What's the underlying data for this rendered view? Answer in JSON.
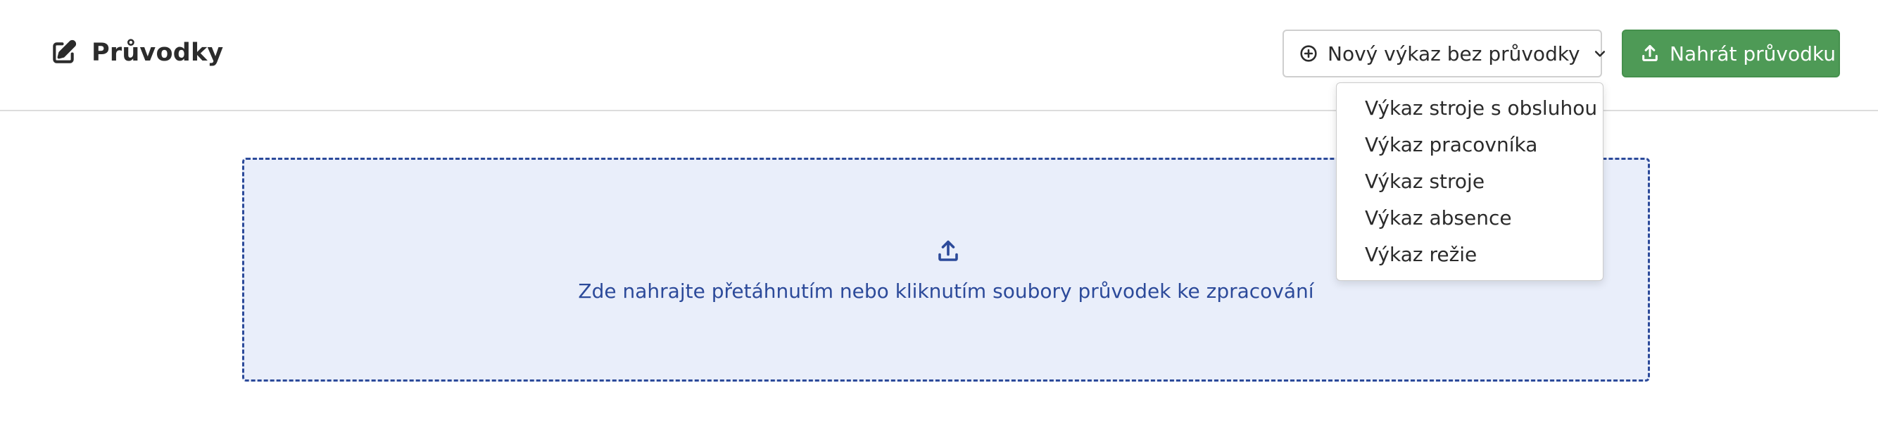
{
  "header": {
    "title": "Průvodky",
    "title_icon": "edit-icon"
  },
  "toolbar": {
    "new_report_label": "Nový výkaz bez průvodky",
    "new_report_icon": "plus-circle-icon",
    "upload_label": "Nahrát průvodku",
    "upload_icon": "upload-icon"
  },
  "dropdown": {
    "items": [
      {
        "label": "Výkaz stroje s obsluhou"
      },
      {
        "label": "Výkaz pracovníka"
      },
      {
        "label": "Výkaz stroje"
      },
      {
        "label": "Výkaz absence"
      },
      {
        "label": "Výkaz režie"
      }
    ]
  },
  "dropzone": {
    "text": "Zde nahrajte přetáhnutím nebo kliknutím soubory průvodek ke zpracování",
    "icon": "upload-icon"
  },
  "colors": {
    "primary_green": "#4e9a56",
    "dropzone_border": "#2c4a9a",
    "dropzone_bg": "#e9eefa"
  }
}
